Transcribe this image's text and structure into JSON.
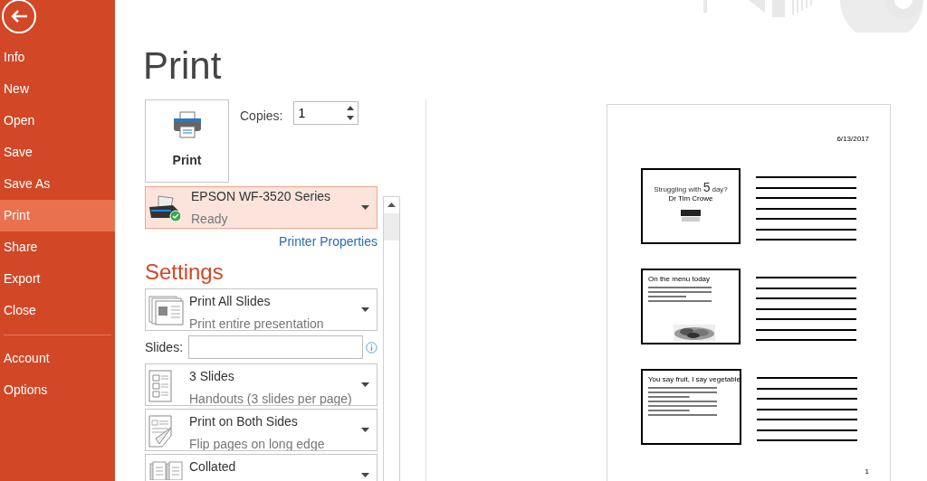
{
  "sidebar": {
    "items": [
      {
        "label": "Info",
        "selected": false
      },
      {
        "label": "New",
        "selected": false
      },
      {
        "label": "Open",
        "selected": false
      },
      {
        "label": "Save",
        "selected": false
      },
      {
        "label": "Save As",
        "selected": false
      },
      {
        "label": "Print",
        "selected": true
      },
      {
        "label": "Share",
        "selected": false
      },
      {
        "label": "Export",
        "selected": false
      },
      {
        "label": "Close",
        "selected": false
      }
    ],
    "bottom_items": [
      {
        "label": "Account",
        "selected": false
      },
      {
        "label": "Options",
        "selected": false
      }
    ]
  },
  "title": "Print",
  "print_button": {
    "label": "Print"
  },
  "copies": {
    "label": "Copies:",
    "value": "1"
  },
  "printer": {
    "name": "EPSON WF-3520 Series",
    "status": "Ready",
    "properties_link": "Printer Properties"
  },
  "settings": {
    "heading": "Settings",
    "options": [
      {
        "kind": "dropdown",
        "title": "Print All Slides",
        "subtitle": "Print entire presentation"
      },
      {
        "kind": "field",
        "label": "Slides:"
      },
      {
        "kind": "dropdown",
        "title": "3 Slides",
        "subtitle": "Handouts (3 slides per page)"
      },
      {
        "kind": "dropdown",
        "title": "Print on Both Sides",
        "subtitle": "Flip pages on long edge"
      },
      {
        "kind": "dropdown",
        "title": "Collated"
      }
    ]
  },
  "preview": {
    "date": "6/13/2017",
    "page_number": "1",
    "slides": [
      {
        "kind": "title",
        "title": "Struggling with",
        "number": "5",
        "title_end": "day?",
        "subtitle": "Dr Tim Crowe"
      },
      {
        "kind": "bullets",
        "title": "On the menu today"
      },
      {
        "kind": "text",
        "title": "You say fruit, I say vegetable"
      }
    ]
  }
}
